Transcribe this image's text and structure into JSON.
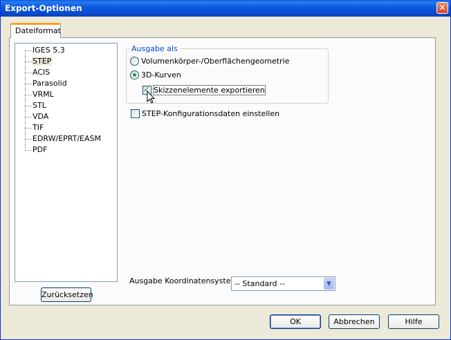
{
  "window": {
    "title": "Export-Optionen",
    "close_glyph": "✕"
  },
  "tab": {
    "label": "Dateiformat"
  },
  "formats": [
    "IGES 5.3",
    "STEP",
    "ACIS",
    "Parasolid",
    "VRML",
    "STL",
    "VDA",
    "TIF",
    "EDRW/EPRT/EASM",
    "PDF"
  ],
  "selected_format": "STEP",
  "reset_button": "Zurücksetzen",
  "output_group": {
    "legend": "Ausgabe als",
    "option_solid": "Volumenkörper-/Oberflächengeometrie",
    "option_curves": "3D-Kurven",
    "selected_option": "3D-Kurven",
    "sketch_checkbox": "Skizzenelemente exportieren",
    "sketch_checked": true
  },
  "step_config": {
    "label": "STEP-Konfigurationsdaten einstellen",
    "checked": false
  },
  "coordinate_system": {
    "label": "Ausgabe Koordinatensystem:",
    "value": "-- Standard --"
  },
  "buttons": {
    "ok": "OK",
    "cancel": "Abbrechen",
    "help": "Hilfe"
  },
  "icons": {
    "close": "close-icon",
    "dropdown": "chevron-down-icon",
    "cursor": "mouse-pointer-icon"
  }
}
